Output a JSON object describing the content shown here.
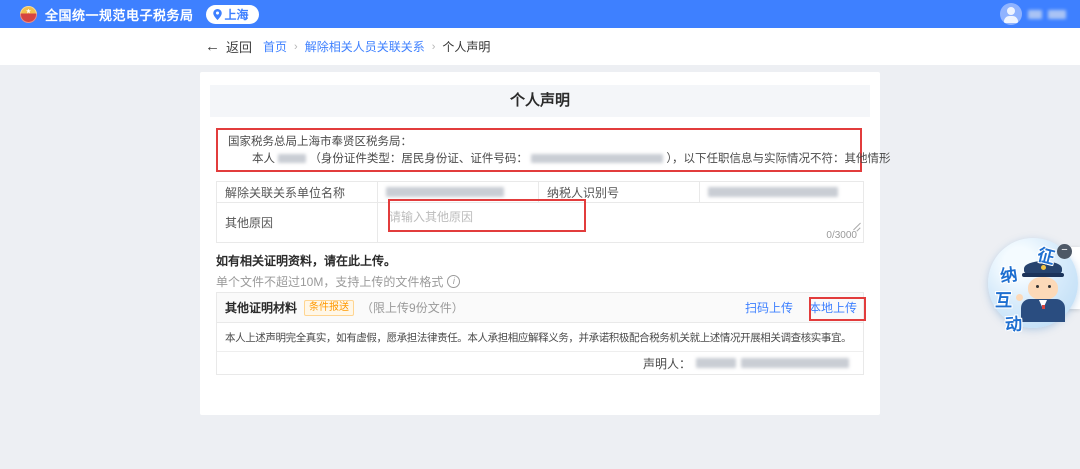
{
  "header": {
    "app_title": "全国统一规范电子税务局",
    "location": "上海"
  },
  "breadcrumb": {
    "back_arrow": "←",
    "back_label": "返回",
    "separator": "›",
    "items": [
      "首页",
      "解除相关人员关联关系",
      "个人声明"
    ]
  },
  "page": {
    "title": "个人声明"
  },
  "declaration": {
    "salutation": "国家税务总局上海市奉贤区税务局：",
    "body_prefix": "本人",
    "body_mid": "（身份证件类型：居民身份证、证件号码：",
    "body_suffix": "），以下任职信息与实际情况不符：其他情形"
  },
  "form": {
    "unit_name_label": "解除关联关系单位名称",
    "taxpayer_id_label": "纳税人识别号",
    "other_reason_label": "其他原因",
    "other_reason_placeholder": "请输入其他原因",
    "char_counter": "0/3000"
  },
  "upload_section": {
    "note_title": "如有相关证明资料，请在此上传。",
    "note_sub": "单个文件不超过10M，支持上传的文件格式",
    "info_icon": "i",
    "material_label": "其他证明材料",
    "badge": "条件报送",
    "limit_note": "（限上传9份文件）",
    "scan_upload_label": "扫码上传",
    "local_upload_label": "本地上传"
  },
  "statement": {
    "text": "本人上述声明完全真实，如有虚假，愿承担法律责任。本人承担相应解释义务，并承诺积极配合税务机关就上述情况开展相关调查核实事宜。",
    "declarant_label": "声明人："
  },
  "assistant_widget": {
    "chars": [
      "征",
      "纳",
      "互",
      "动"
    ],
    "minimize_icon": "−"
  },
  "colors": {
    "header_blue": "#3e80ff",
    "link_blue": "#3e80ff",
    "annotation_red": "#e23c3c",
    "badge_orange": "#ff9900"
  }
}
